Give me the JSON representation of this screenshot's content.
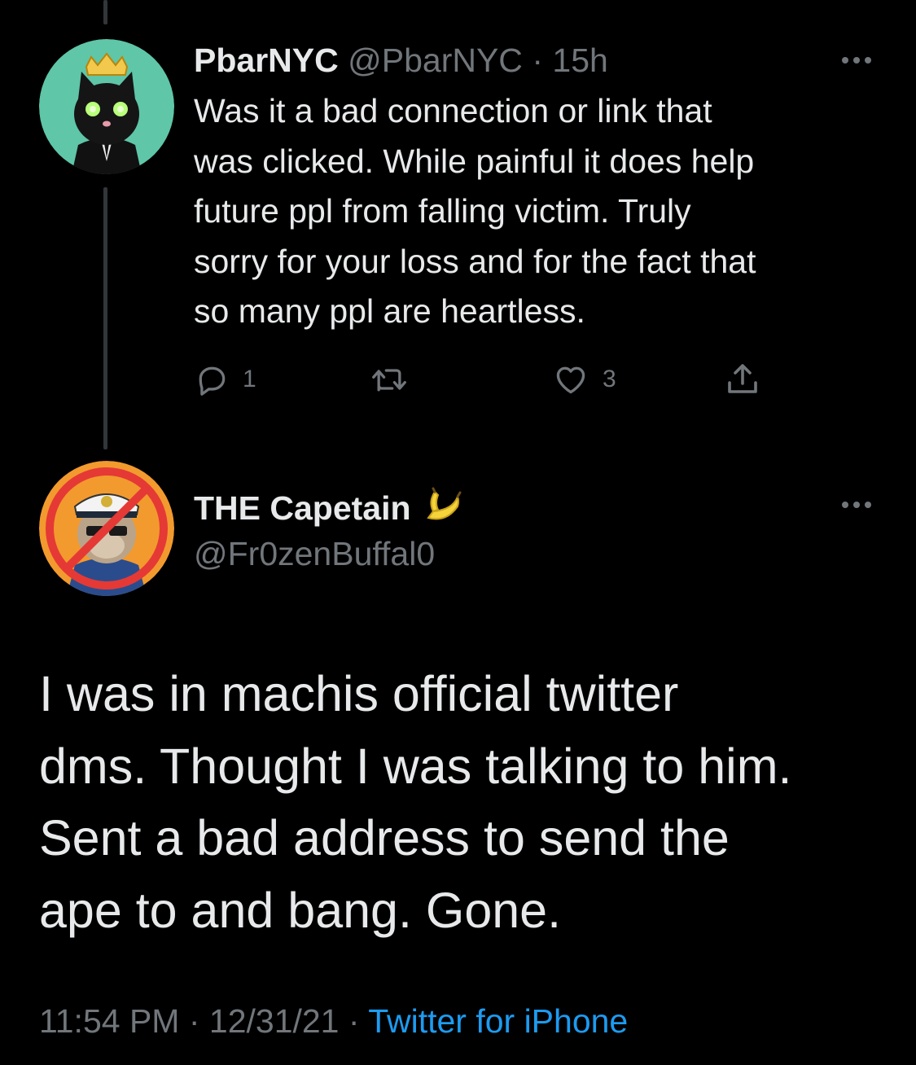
{
  "reply_tweet": {
    "display_name": "PbarNYC",
    "handle": "@PbarNYC",
    "separator": "·",
    "time": "15h",
    "text": "Was it a bad connection or link that\nwas clicked. While painful it does help\nfuture ppl from falling victim. Truly\nsorry for your loss and for the fact that\nso many ppl are heartless.",
    "actions": {
      "reply_count": "1",
      "retweet_count": "",
      "like_count": "3"
    },
    "avatar_icon": "black-cat-with-crown-avatar"
  },
  "main_tweet": {
    "display_name": "THE Capetain",
    "name_emoji": "🍌",
    "handle": "@Fr0zenBuffal0",
    "text": "I was in machis official twitter\ndms. Thought I was talking to him.\nSent a bad address to send the\nape to and bang. Gone.",
    "meta": {
      "time": "11:54 PM",
      "sep1": " · ",
      "date": "12/31/21",
      "sep2": " · ",
      "source": "Twitter for iPhone"
    },
    "avatar_icon": "ape-captain-crossed-avatar"
  },
  "colors": {
    "background": "#000000",
    "text": "#E7E9EA",
    "secondary": "#71767B",
    "link": "#1D9BF0",
    "thread_line": "#333639"
  },
  "icons": [
    "reply-icon",
    "retweet-icon",
    "like-icon",
    "share-icon",
    "more-icon",
    "banana-icon"
  ]
}
